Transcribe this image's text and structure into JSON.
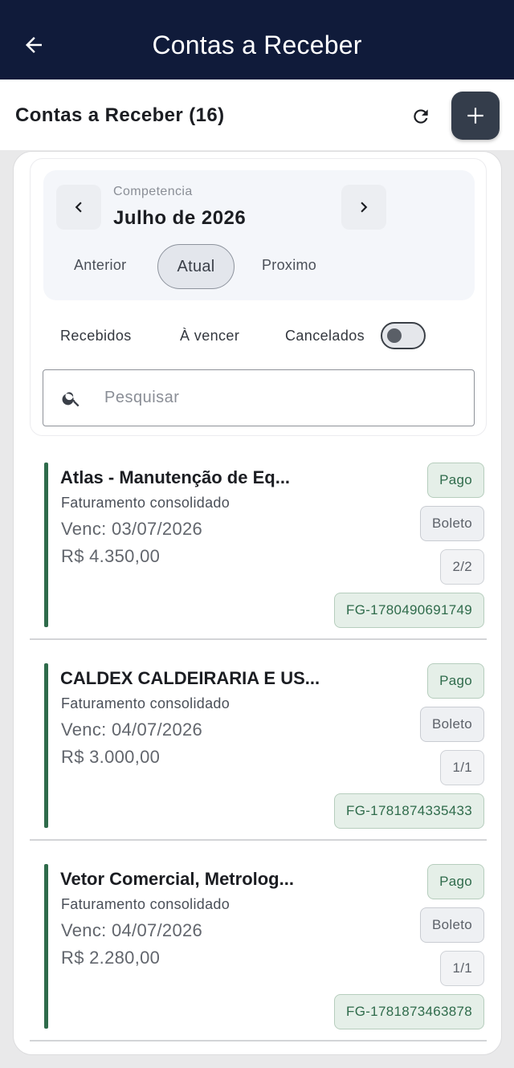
{
  "topbar": {
    "title": "Contas a Receber",
    "back_icon": "arrow-left-icon"
  },
  "subheader": {
    "title": "Contas a Receber (16)",
    "refresh_icon": "refresh-icon",
    "add_icon": "plus-icon"
  },
  "competencia": {
    "label": "Competencia",
    "value": "Julho de 2026",
    "prev_icon": "chevron-left-icon",
    "next_icon": "chevron-right-icon",
    "periods": {
      "anterior": "Anterior",
      "atual": "Atual",
      "proximo": "Proximo"
    },
    "selected_period": "Atual"
  },
  "filters": {
    "recebidos": "Recebidos",
    "a_vencer": "À vencer",
    "cancelados": "Cancelados",
    "cancelados_toggle_on": false
  },
  "search": {
    "placeholder": "Pesquisar",
    "value": "",
    "icon": "search-icon"
  },
  "items": [
    {
      "title": "Atlas - Manutenção de Eq...",
      "subtitle": "Faturamento consolidado",
      "venc": "Venc: 03/07/2026",
      "valor": "R$ 4.350,00",
      "status": "Pago",
      "method": "Boleto",
      "parcela": "2/2",
      "code": "FG-1780490691749"
    },
    {
      "title": "CALDEX CALDEIRARIA E US...",
      "subtitle": "Faturamento consolidado",
      "venc": "Venc: 04/07/2026",
      "valor": "R$ 3.000,00",
      "status": "Pago",
      "method": "Boleto",
      "parcela": "1/1",
      "code": "FG-1781874335433"
    },
    {
      "title": "Vetor Comercial, Metrolog...",
      "subtitle": "Faturamento consolidado",
      "venc": "Venc: 04/07/2026",
      "valor": "R$ 2.280,00",
      "status": "Pago",
      "method": "Boleto",
      "parcela": "1/1",
      "code": "FG-1781873463878"
    }
  ],
  "colors": {
    "header_bg": "#101b3a",
    "accent_green": "#2f6b4b",
    "add_button_bg": "#343d4b"
  }
}
